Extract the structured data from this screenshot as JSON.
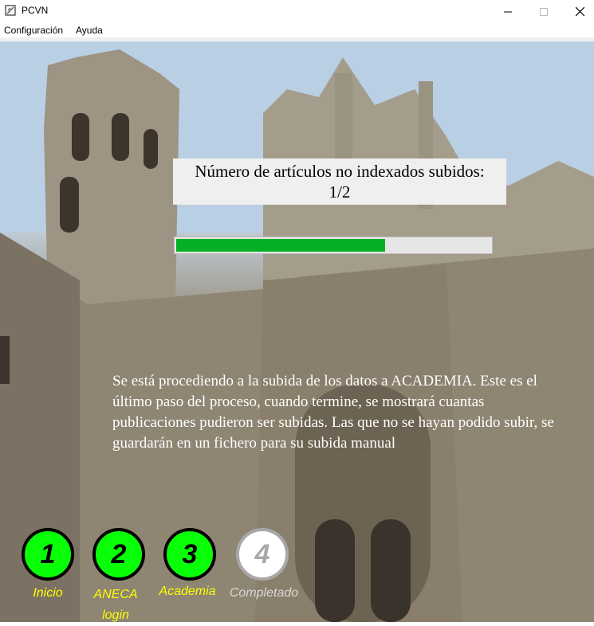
{
  "window": {
    "title": "PCVN",
    "minimize_icon": "minimize-icon",
    "maximize_icon": "maximize-icon",
    "close_icon": "close-icon"
  },
  "menu": {
    "items": [
      "Configuración",
      "Ayuda"
    ]
  },
  "status": {
    "heading": "Número de artículos no indexados subidos:",
    "count": "1/2"
  },
  "progress": {
    "value": 0.66,
    "color": "#06b025"
  },
  "message": "Se está procediendo a la subida de los datos a ACADEMIA. Este es el último paso del proceso, cuando termine, se mostrará cuantas publicaciones pudieron ser subidas. Las que no se hayan podido subir, se guardarán en un fichero para su subida manual",
  "steps": [
    {
      "number": "1",
      "label": "Inicio",
      "state": "done"
    },
    {
      "number": "2",
      "label": "ANECA login",
      "state": "done"
    },
    {
      "number": "3",
      "label": "Academia",
      "state": "done"
    },
    {
      "number": "4",
      "label": "Completado",
      "state": "pending"
    }
  ],
  "colors": {
    "step_done": "#08ff08",
    "step_label": "#ffff00",
    "step_pending": "#a8a8a8"
  }
}
